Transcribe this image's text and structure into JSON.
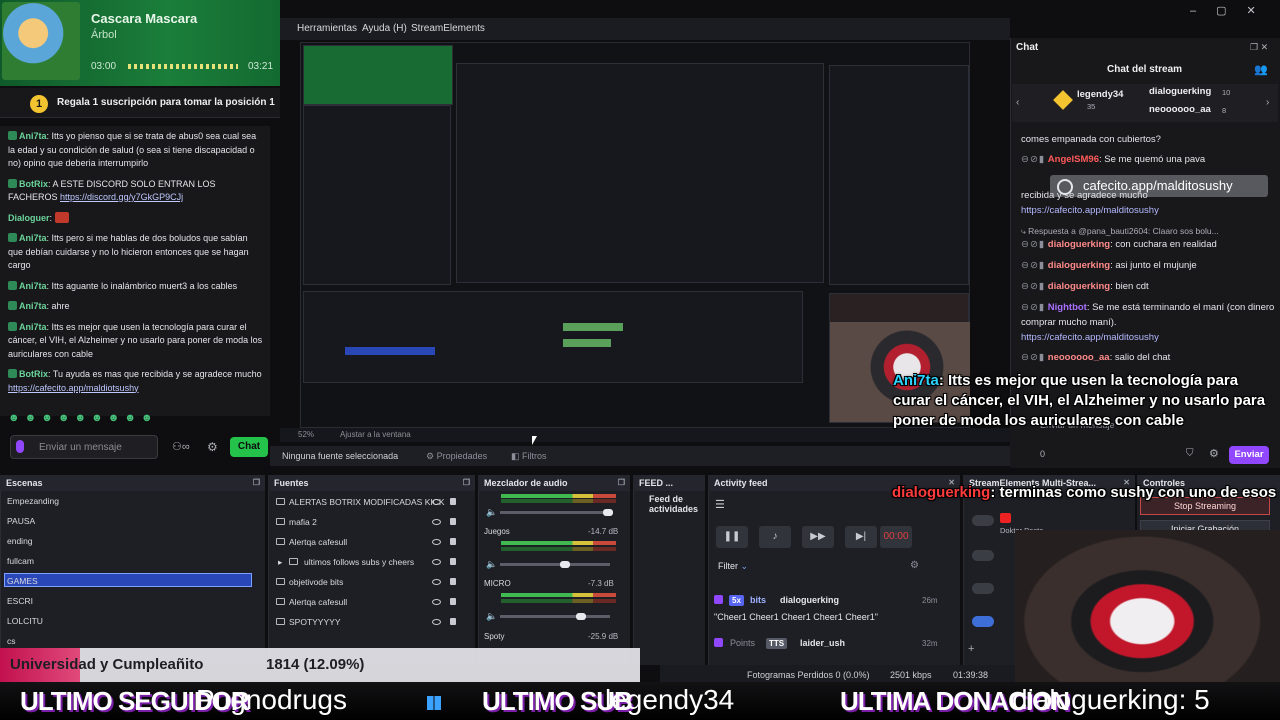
{
  "now_playing": {
    "title": "Cascara Mascara",
    "artist": "Árbol",
    "time_start": "03:00",
    "time_end": "03:21",
    "progress_fraction": 0.93
  },
  "pinned": {
    "badge": "1",
    "text": "Regala 1 suscripción para tomar la posición 1"
  },
  "chat_left": {
    "messages": [
      {
        "user": "Ani7ta",
        "text": "Itts yo pienso que si se trata de abus0 sea cual sea la edad y su condición de salud (o sea si tiene discapacidad o no) opino que deberia interrumpirlo",
        "color": "green"
      },
      {
        "user": "BotRix",
        "text": "A ESTE DISCORD SOLO ENTRAN LOS FACHEROS",
        "link": "https://discord.gg/y7GkGP9CJj",
        "color": "green"
      },
      {
        "user": "Dialoguer",
        "text": "",
        "color": "green"
      },
      {
        "user": "Ani7ta",
        "text": "Itts pero si me hablas de dos boludos que sabían que debían cuidarse y no lo hicieron entonces que se hagan cargo",
        "color": "green"
      },
      {
        "user": "Ani7ta",
        "text": "Itts aguante lo inalámbrico muert3 a los cables",
        "color": "green"
      },
      {
        "user": "Ani7ta",
        "text": "ahre",
        "color": "green"
      },
      {
        "user": "Ani7ta",
        "text": "Itts es mejor que usen la tecnología para curar el cáncer, el VIH, el Alzheimer y no usarlo para poner de moda los auriculares con cable",
        "color": "green"
      },
      {
        "user": "BotRix",
        "text": "Tu ayuda es mas que recibida y se agradece mucho",
        "link": "https://cafecito.app/maldiotsushy",
        "color": "green"
      }
    ],
    "emote_row": "☻ ☻ ☻ ☻ ☻ ☻ ☻ ☻ ☻",
    "input_placeholder": "Enviar un mensaje",
    "chat_button": "Chat"
  },
  "obs": {
    "menu": [
      "Herramientas",
      "Ayuda (H)",
      "StreamElements"
    ],
    "zoom": "52%",
    "fit": "Ajustar a la ventana",
    "no_source": "Ninguna fuente seleccionada",
    "properties": "Propiedades",
    "filters": "Filtros",
    "docks": {
      "scenes": "Escenas",
      "sources": "Fuentes",
      "mixer": "Mezclador de audio",
      "feed": "FEED ...",
      "feed_sub": "Feed de actividades",
      "activity": "Activity feed",
      "multistream": "StreamElements Multi-Strea...",
      "controls": "Controles"
    },
    "scenes": [
      "Empezanding",
      "PAUSA",
      "ending",
      "fullcam",
      "GAMES",
      "ESCRI",
      "LOLCITU",
      "cs"
    ],
    "selected_scene": "GAMES",
    "sources": [
      {
        "name": "ALERTAS BOTRIX MODIFICADAS KICK",
        "icon": "browser-icon"
      },
      {
        "name": "mafia 2",
        "icon": "image-icon"
      },
      {
        "name": "Alertqa cafesull",
        "icon": "browser-icon"
      },
      {
        "name": "ultimos follows subs y cheers",
        "icon": "group-icon"
      },
      {
        "name": "objetivode bits",
        "icon": "browser-icon"
      },
      {
        "name": "Alertqa cafesull",
        "icon": "browser-icon"
      },
      {
        "name": "SPOTYYYYY",
        "icon": "browser-icon"
      }
    ],
    "mixer": [
      {
        "name": "",
        "db": "",
        "level": 0.9
      },
      {
        "name": "Juegos",
        "db": "-14.7 dB",
        "level": 0.6
      },
      {
        "name": "MICRO",
        "db": "-7.3 dB",
        "level": 0.85
      },
      {
        "name": "Spoty",
        "db": "-25.9 dB",
        "level": 0.4
      }
    ],
    "activity_feed": {
      "filter": "Filter",
      "items": [
        {
          "badge": "5x",
          "type": "bits",
          "user": "dialoguerking",
          "time": "26m",
          "text": "\"Cheer1 Cheer1 Cheer1 Cheer1 Cheer1\""
        },
        {
          "badge": "TTS",
          "type": "Points",
          "user": "laider_ush",
          "time": "32m",
          "text": ""
        }
      ]
    },
    "multistream": {
      "target": "Doktor Peste"
    },
    "controls": {
      "stop_streaming": "Stop Streaming",
      "start_recording": "Iniciar Grabación"
    },
    "status": {
      "frames_dropped": "Fotogramas Perdidos 0 (0.0%)",
      "bitrate": "2501 kbps",
      "live_time": "01:39:38"
    }
  },
  "chat_right": {
    "tab": "Chat",
    "title": "Chat del stream",
    "leaders": [
      {
        "name": "legendy34",
        "sub": "35"
      },
      {
        "name": "dialoguerking",
        "sub": "10"
      },
      {
        "name": "neoooooo_aa",
        "sub": "8"
      }
    ],
    "messages": [
      {
        "user": "",
        "text": "comes empanada con cubiertos?"
      },
      {
        "user": "AngelSM96",
        "text": "Se me quemó una pava"
      },
      {
        "user": "",
        "text": "recibida y se agradece mucho",
        "link": "https://cafecito.app/malditosushy"
      },
      {
        "user": "Respuesta a @pana_bauti2604:",
        "text": "Claaro sos bolu..."
      },
      {
        "user": "dialoguerking",
        "text": "con cuchara en realidad"
      },
      {
        "user": "dialoguerking",
        "text": "asi junto el mujunje"
      },
      {
        "user": "dialoguerking",
        "text": "bien cdt"
      },
      {
        "user": "Nightbot",
        "text": "Se me está terminando el maní (con dinero comprar mucho maní).",
        "link": "https://cafecito.app/malditosushy"
      },
      {
        "user": "neoooooo_aa",
        "text": "salio del chat"
      }
    ],
    "cafecito_overlay": "cafecito.app/malditosushy",
    "input_placeholder": "Enviar un mensaje",
    "points": "0",
    "send": "Enviar"
  },
  "overlay": {
    "msg1_user": "Ani7ta",
    "msg1_text": ": Itts es mejor que usen la tecnología para curar el cáncer, el VIH, el Alzheimer y no usarlo para poner de moda los auriculares con cable",
    "msg2_user": "dialoguerking",
    "msg2_text": ": terminas como sushy con uno de esos",
    "goal_name": "Universidad y Cumpleañito",
    "goal_count": "1814 (12.09%)",
    "goal_fraction": 0.1209,
    "ticker": [
      {
        "label": "ULTIMO SEGUIDOR",
        "value": "Pugnodrugs"
      },
      {
        "label": "ULTIMO SUB",
        "value": "legendy34"
      },
      {
        "label": "ULTIMA DONACION",
        "value": "dialoguerking: 5"
      }
    ]
  }
}
